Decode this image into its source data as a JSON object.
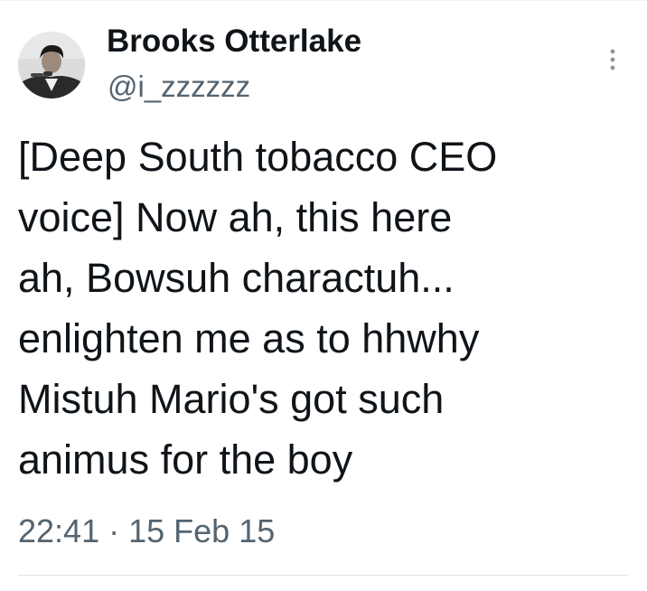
{
  "tweet": {
    "display_name": "Brooks Otterlake",
    "handle": "@i_zzzzzz",
    "text": "[Deep South tobacco CEO\nvoice] Now ah, this here\nah, Bowsuh charactuh...\nenlighten me as to hhwhy\nMistuh Mario's got such\nanimus for the boy",
    "time": "22:41",
    "separator": "·",
    "date": "15 Feb 15"
  },
  "icons": {
    "avatar": "profile-photo",
    "more": "vertical-ellipsis-icon"
  },
  "colors": {
    "primary_text": "#0f1419",
    "secondary_text": "#536471",
    "divider": "#dfe3e6"
  }
}
